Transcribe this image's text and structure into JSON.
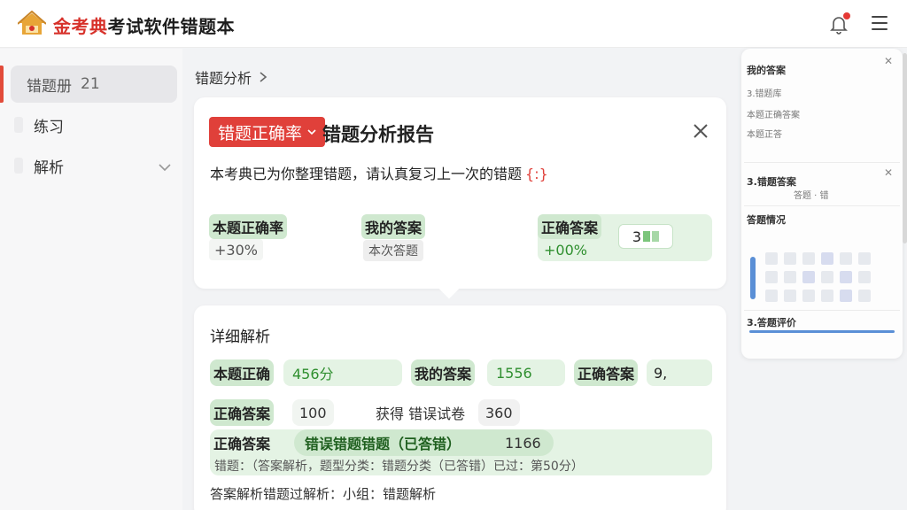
{
  "app": {
    "title_brand": "金考典",
    "title_rest": "考试软件错题本"
  },
  "sidebar": {
    "items": [
      {
        "label": "错题册",
        "count": "21",
        "active": true
      },
      {
        "label": "练习"
      },
      {
        "label": "解析"
      }
    ]
  },
  "breadcrumb": {
    "label": "错题分析"
  },
  "summary_card": {
    "tag": "错题正确率",
    "title": "错题分析报告",
    "description": "本考典已为你整理错题，请认真复习上一次的错题",
    "deco": "{:}",
    "stats": [
      {
        "label": "本题正确率",
        "value": "+30%"
      },
      {
        "label": "我的答案",
        "value": "本次答题"
      },
      {
        "label": "正确答案",
        "value": "+00%",
        "chip": "3"
      }
    ]
  },
  "detail_card": {
    "title": "详细解析",
    "row1": [
      {
        "label": "本题正确",
        "value": "456分"
      },
      {
        "label": "我的答案",
        "value": "1556"
      },
      {
        "label": "正确答案",
        "value": "9,"
      }
    ],
    "row2": [
      {
        "label": "正确答案",
        "value": "100"
      },
      {
        "label": "获得 错误试卷",
        "value": "360"
      }
    ],
    "row3": {
      "label": "正确答案",
      "highlight": "错误错题错题（已答错）",
      "value": "1166",
      "sub": "错题：（答案解析，题型分类：错题分类（已答错）已过：第50分）"
    },
    "footer": "答案解析错题过解析：小组：错题解析"
  },
  "right_panel": {
    "sections": [
      {
        "title": "我的答案",
        "sub1": "3.错题库",
        "sub2": "本题正确答案",
        "sub3": "本题正答"
      },
      {
        "title": "3.错题答案",
        "sub1": "答题 · 错"
      },
      {
        "title": "答题情况"
      },
      {
        "title": "3.答题评价"
      }
    ]
  },
  "colors": {
    "brand_red": "#d7312a",
    "tag_red": "#e0403a",
    "green_light": "#e4f3e4",
    "green_mid": "#cfe8cf",
    "accent_blue": "#5a8fd6"
  },
  "icons": [
    "logo-icon",
    "bell-icon",
    "menu-icon",
    "chevron-right-icon",
    "chevron-down-icon",
    "close-icon",
    "caret-down-icon"
  ]
}
